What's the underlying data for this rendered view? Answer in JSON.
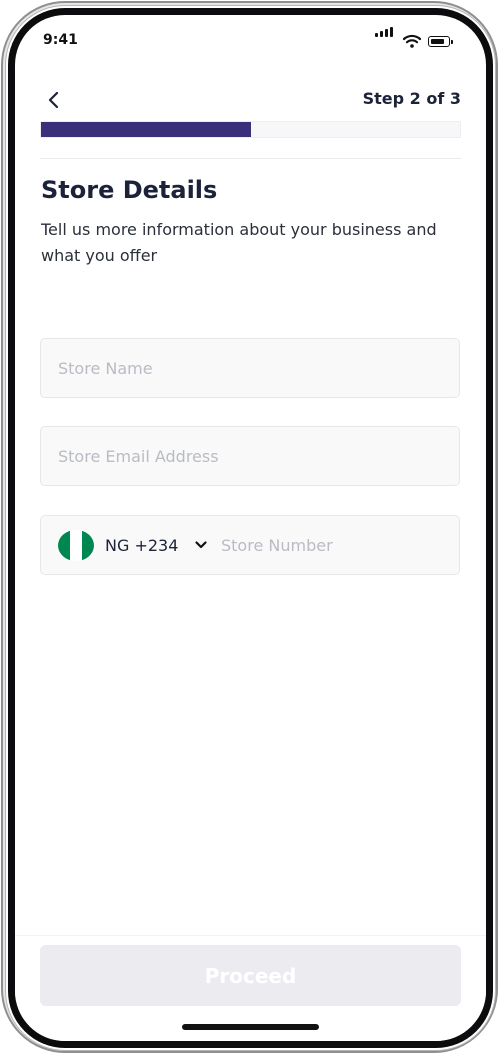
{
  "status_bar": {
    "time": "9:41",
    "icons": [
      "cellular-signal-icon",
      "wifi-icon",
      "battery-icon"
    ]
  },
  "header": {
    "back_icon": "chevron-left-icon",
    "step_label": "Step 2 of 3",
    "progress": {
      "current": 2,
      "total": 3,
      "fraction": 0.5,
      "fill_color": "#3a2f79"
    }
  },
  "content": {
    "title": "Store Details",
    "subtitle": "Tell us more information about your business and what you offer"
  },
  "form": {
    "store_name": {
      "placeholder": "Store Name",
      "value": ""
    },
    "store_email": {
      "placeholder": "Store Email Address",
      "value": ""
    },
    "store_number": {
      "country_flag": "nigeria-flag-icon",
      "country_code": "NG +234",
      "placeholder": "Store Number",
      "value": ""
    }
  },
  "footer": {
    "proceed_label": "Proceed",
    "proceed_state": "disabled"
  },
  "colors": {
    "primary": "#3a2f79",
    "heading": "#1c2238",
    "flag_green": "#008751",
    "button_disabled_bg": "#ebebf0"
  }
}
